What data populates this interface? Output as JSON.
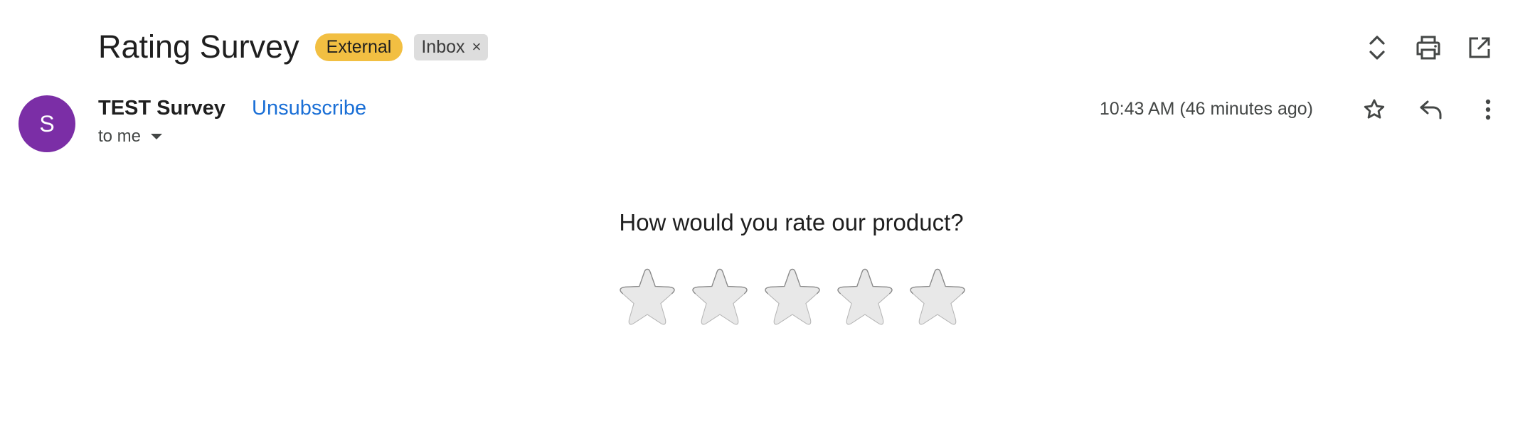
{
  "email": {
    "subject": "Rating Survey",
    "labels": {
      "external": "External",
      "inbox": "Inbox",
      "inbox_remove": "×"
    },
    "sender": {
      "initial": "S",
      "name": "TEST Survey",
      "unsubscribe": "Unsubscribe",
      "recipient": "to me",
      "timestamp": "10:43 AM (46 minutes ago)"
    },
    "icons": {
      "top": [
        "expand-collapse-icon",
        "print-icon",
        "open-in-new-window-icon"
      ],
      "message": [
        "star-icon",
        "reply-icon",
        "more-vert-icon"
      ]
    }
  },
  "survey": {
    "question": "How would you rate our product?",
    "star_count": 5,
    "rating": 0
  },
  "colors": {
    "avatar": "#7b2ea6",
    "external_label": "#f2bf42",
    "inbox_label": "#dddddd",
    "link": "#1a6fd6",
    "star_fill": "#e8e8e8"
  }
}
